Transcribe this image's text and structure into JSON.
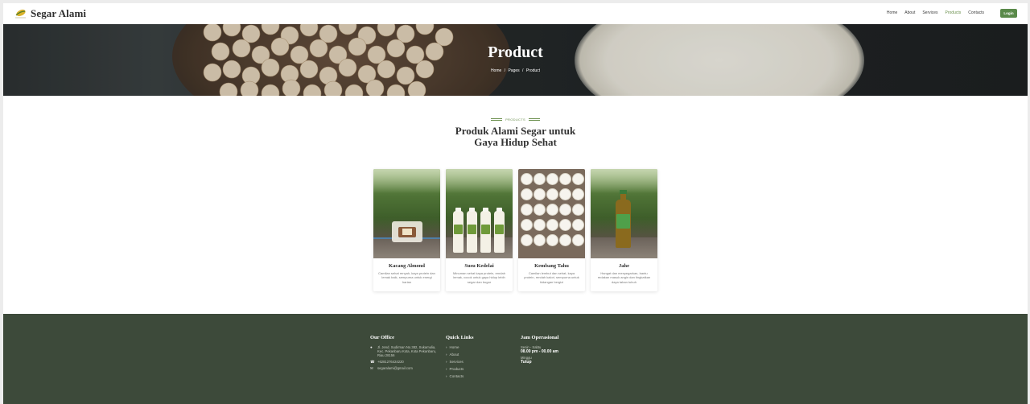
{
  "brand": {
    "name": "Segar Alami",
    "logo_caption": "SEGAR"
  },
  "nav": {
    "links": [
      "Home",
      "About",
      "Services",
      "Products",
      "Contacts"
    ],
    "active_index": 3,
    "login_label": "Login",
    "accent_color": "#5a8a4a"
  },
  "hero": {
    "title": "Product",
    "breadcrumb": [
      "Home",
      "Pages",
      "Product"
    ],
    "separator": "/"
  },
  "section": {
    "tag": "PRODUCTS",
    "title": "Produk Alami Segar untuk Gaya Hidup Sehat"
  },
  "products": [
    {
      "name": "Kacang Almond",
      "desc": "Camilan sehat renyah, kaya protein dan lemak baik, sempurna untuk energi harian"
    },
    {
      "name": "Susu Kedelai",
      "desc": "Minuman sehat kaya protein, rendah lemak, cocok untuk gaya hidup lebih segar dan bugar"
    },
    {
      "name": "Kembang Tahu",
      "desc": "Camilan lembut dan sehat, kaya protein, rendah kalori, sempurna untuk hidangan bergizi"
    },
    {
      "name": "Jahe",
      "desc": "Hangat dan menyegarkan, bantu redakan masuk angin dan tingkatkan daya tahan tubuh"
    }
  ],
  "footer": {
    "office": {
      "title": "Our Office",
      "address": "Jl. Jend. Sudirman No.382, Sukamulia, Kec. Pekanbaru Kota, Kota Pekanbaru, Riau 28156",
      "phone": "+6281276424220",
      "email": "segaralami@gmail.com"
    },
    "quick_links": {
      "title": "Quick Links",
      "items": [
        "Home",
        "About",
        "Services",
        "Products",
        "Contacts"
      ]
    },
    "hours": {
      "title": "Jam Operasional",
      "weekday_label": "Senin - Sabtu",
      "weekday_value": "08.00 pm - 00.00 am",
      "sunday_label": "Minggu",
      "sunday_value": "Tutup"
    },
    "background_color": "#3d4a3a"
  }
}
